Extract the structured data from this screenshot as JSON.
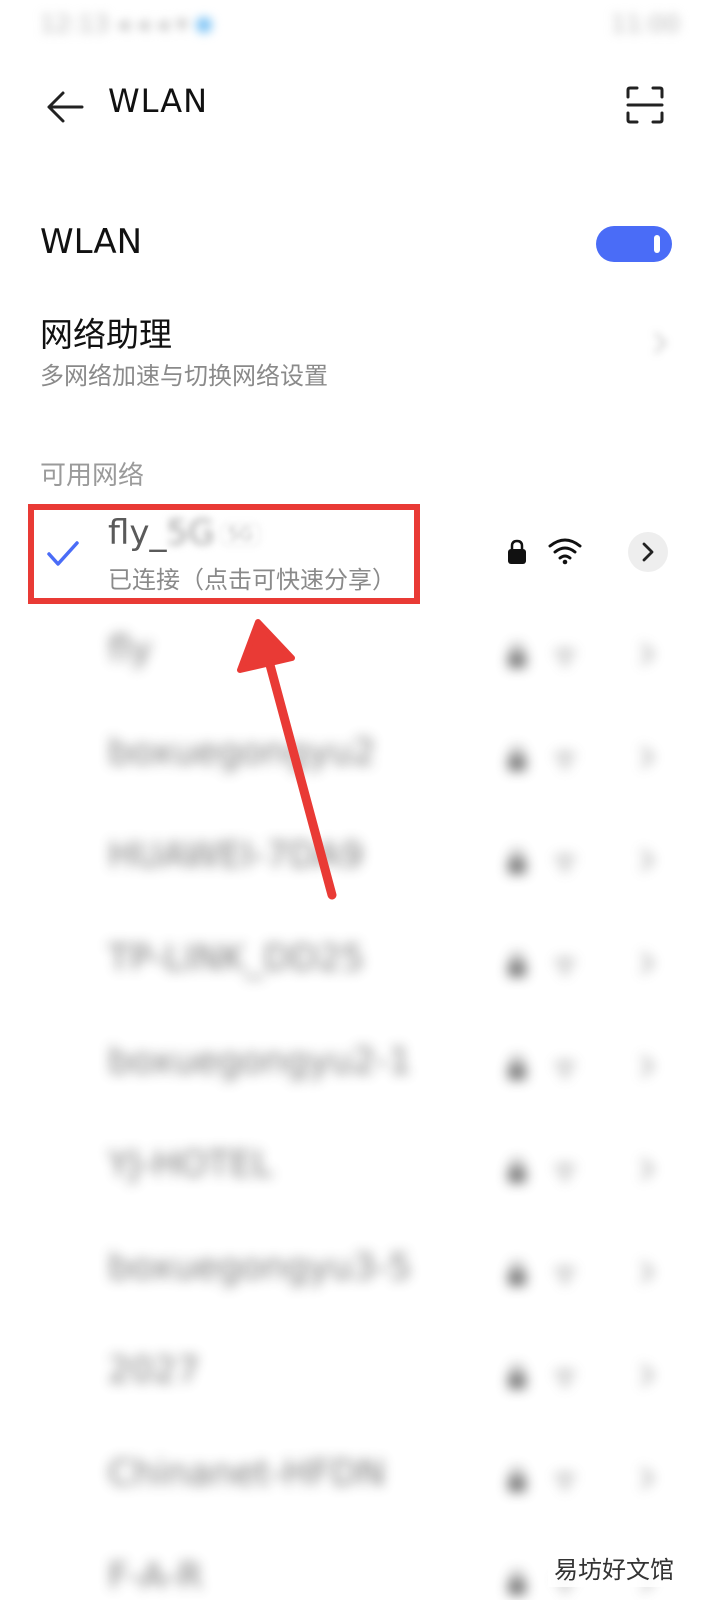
{
  "status_bar": {
    "left": "12:13 ◂ ◂ ◂ ▾",
    "right": "11:00"
  },
  "app_bar": {
    "title": "WLAN",
    "back_icon": "back-arrow-icon",
    "scan_icon": "scan-icon"
  },
  "wlan_toggle": {
    "label": "WLAN",
    "enabled": true,
    "accent_color": "#4a6cf7"
  },
  "network_assistant": {
    "title": "网络助理",
    "subtitle": "多网络加速与切换网络设置",
    "chevron": "›"
  },
  "available_networks": {
    "header": "可用网络",
    "connected": {
      "ssid_prefix": "fly_",
      "ssid_blurred": "5G",
      "badge": "5G",
      "status": "已连接（点击可快速分享）",
      "check_color": "#4a6cf7"
    },
    "others": [
      {
        "ssid": "fly"
      },
      {
        "ssid": "boxuegongyu2"
      },
      {
        "ssid": "HUAWEI-7DA9"
      },
      {
        "ssid": "TP-LINK_DD25"
      },
      {
        "ssid": "boxuegongyu2-1"
      },
      {
        "ssid": "YJ-HOTEL"
      },
      {
        "ssid": "boxuegongyu3-5"
      },
      {
        "ssid": "2027"
      },
      {
        "ssid": "Chinanet-HFDN"
      },
      {
        "ssid": "F-A-R"
      }
    ]
  },
  "annotation": {
    "color": "#e93a35"
  },
  "watermark": "易坊好文馆"
}
